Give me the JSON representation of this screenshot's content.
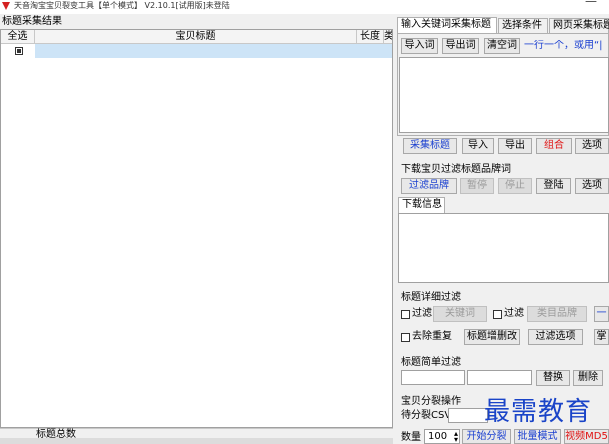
{
  "window": {
    "title": "天音淘宝宝贝裂变工具【单个模式】 V2.10.1[试用版]未登陆",
    "minimize": "—"
  },
  "left": {
    "section_title": "标题采集结果",
    "columns": [
      "全选",
      "宝贝标题",
      "长度",
      "类"
    ],
    "footer_label": "标题总数"
  },
  "right": {
    "tabs": [
      "输入关键词采集标题",
      "选择条件",
      "网页采集标题"
    ],
    "keyword_toolbar": {
      "import_words": "导入词",
      "export_words": "导出词",
      "clear_words": "清空词",
      "hint": "一行一个，或用“|"
    },
    "collect_toolbar": {
      "collect": "采集标题",
      "import": "导入",
      "export": "导出",
      "combine": "组合",
      "options": "选项"
    },
    "brand_filter": {
      "title": "下载宝贝过滤标题品牌词",
      "filter_brand": "过滤品牌",
      "pause": "暂停",
      "stop": "停止",
      "login": "登陆",
      "options": "选项"
    },
    "download": {
      "tab": "下载信息"
    },
    "detail_filter": {
      "title": "标题详细过滤",
      "filter1": "过滤",
      "keyword": "关键词",
      "filter2": "过滤",
      "category_brand": "类目品牌",
      "more": "一",
      "dedupe": "去除重复",
      "title_edit": "标题增删改",
      "filter_options": "过滤选项",
      "last": "掌"
    },
    "simple_filter": {
      "title": "标题简单过滤",
      "replace": "替换",
      "delete": "删除"
    },
    "split": {
      "title": "宝贝分裂操作",
      "csv_label": "待分裂CSV"
    },
    "bottom": {
      "qty_label": "数量",
      "qty_value": "100",
      "start_split": "开始分裂",
      "batch_mode": "批量模式",
      "video": "视频MD5"
    }
  },
  "watermark": "最需教育",
  "colors": {
    "accent_blue": "#1a3fd0",
    "accent_red": "#e01010",
    "selection": "#cde4f7"
  }
}
